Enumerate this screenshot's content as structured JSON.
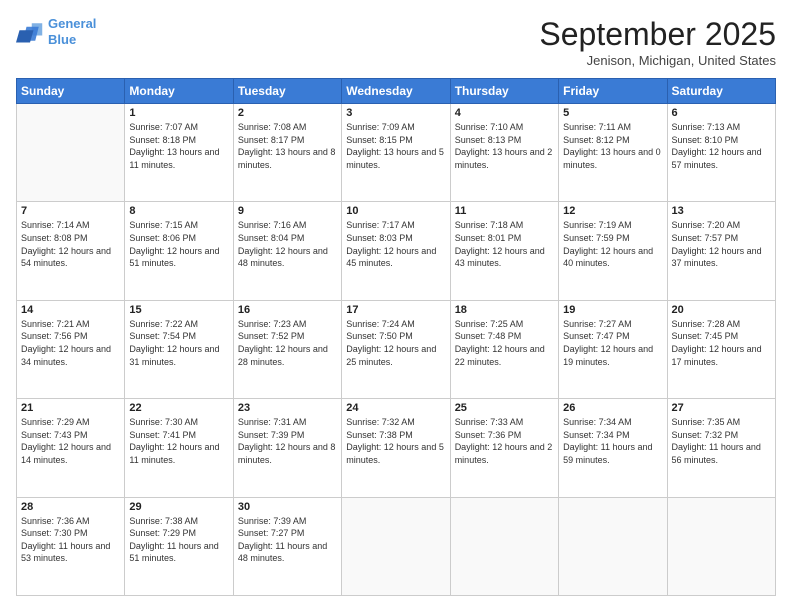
{
  "header": {
    "logo_line1": "General",
    "logo_line2": "Blue",
    "title": "September 2025",
    "location": "Jenison, Michigan, United States"
  },
  "weekdays": [
    "Sunday",
    "Monday",
    "Tuesday",
    "Wednesday",
    "Thursday",
    "Friday",
    "Saturday"
  ],
  "weeks": [
    [
      {
        "day": "",
        "sunrise": "",
        "sunset": "",
        "daylight": ""
      },
      {
        "day": "1",
        "sunrise": "Sunrise: 7:07 AM",
        "sunset": "Sunset: 8:18 PM",
        "daylight": "Daylight: 13 hours and 11 minutes."
      },
      {
        "day": "2",
        "sunrise": "Sunrise: 7:08 AM",
        "sunset": "Sunset: 8:17 PM",
        "daylight": "Daylight: 13 hours and 8 minutes."
      },
      {
        "day": "3",
        "sunrise": "Sunrise: 7:09 AM",
        "sunset": "Sunset: 8:15 PM",
        "daylight": "Daylight: 13 hours and 5 minutes."
      },
      {
        "day": "4",
        "sunrise": "Sunrise: 7:10 AM",
        "sunset": "Sunset: 8:13 PM",
        "daylight": "Daylight: 13 hours and 2 minutes."
      },
      {
        "day": "5",
        "sunrise": "Sunrise: 7:11 AM",
        "sunset": "Sunset: 8:12 PM",
        "daylight": "Daylight: 13 hours and 0 minutes."
      },
      {
        "day": "6",
        "sunrise": "Sunrise: 7:13 AM",
        "sunset": "Sunset: 8:10 PM",
        "daylight": "Daylight: 12 hours and 57 minutes."
      }
    ],
    [
      {
        "day": "7",
        "sunrise": "Sunrise: 7:14 AM",
        "sunset": "Sunset: 8:08 PM",
        "daylight": "Daylight: 12 hours and 54 minutes."
      },
      {
        "day": "8",
        "sunrise": "Sunrise: 7:15 AM",
        "sunset": "Sunset: 8:06 PM",
        "daylight": "Daylight: 12 hours and 51 minutes."
      },
      {
        "day": "9",
        "sunrise": "Sunrise: 7:16 AM",
        "sunset": "Sunset: 8:04 PM",
        "daylight": "Daylight: 12 hours and 48 minutes."
      },
      {
        "day": "10",
        "sunrise": "Sunrise: 7:17 AM",
        "sunset": "Sunset: 8:03 PM",
        "daylight": "Daylight: 12 hours and 45 minutes."
      },
      {
        "day": "11",
        "sunrise": "Sunrise: 7:18 AM",
        "sunset": "Sunset: 8:01 PM",
        "daylight": "Daylight: 12 hours and 43 minutes."
      },
      {
        "day": "12",
        "sunrise": "Sunrise: 7:19 AM",
        "sunset": "Sunset: 7:59 PM",
        "daylight": "Daylight: 12 hours and 40 minutes."
      },
      {
        "day": "13",
        "sunrise": "Sunrise: 7:20 AM",
        "sunset": "Sunset: 7:57 PM",
        "daylight": "Daylight: 12 hours and 37 minutes."
      }
    ],
    [
      {
        "day": "14",
        "sunrise": "Sunrise: 7:21 AM",
        "sunset": "Sunset: 7:56 PM",
        "daylight": "Daylight: 12 hours and 34 minutes."
      },
      {
        "day": "15",
        "sunrise": "Sunrise: 7:22 AM",
        "sunset": "Sunset: 7:54 PM",
        "daylight": "Daylight: 12 hours and 31 minutes."
      },
      {
        "day": "16",
        "sunrise": "Sunrise: 7:23 AM",
        "sunset": "Sunset: 7:52 PM",
        "daylight": "Daylight: 12 hours and 28 minutes."
      },
      {
        "day": "17",
        "sunrise": "Sunrise: 7:24 AM",
        "sunset": "Sunset: 7:50 PM",
        "daylight": "Daylight: 12 hours and 25 minutes."
      },
      {
        "day": "18",
        "sunrise": "Sunrise: 7:25 AM",
        "sunset": "Sunset: 7:48 PM",
        "daylight": "Daylight: 12 hours and 22 minutes."
      },
      {
        "day": "19",
        "sunrise": "Sunrise: 7:27 AM",
        "sunset": "Sunset: 7:47 PM",
        "daylight": "Daylight: 12 hours and 19 minutes."
      },
      {
        "day": "20",
        "sunrise": "Sunrise: 7:28 AM",
        "sunset": "Sunset: 7:45 PM",
        "daylight": "Daylight: 12 hours and 17 minutes."
      }
    ],
    [
      {
        "day": "21",
        "sunrise": "Sunrise: 7:29 AM",
        "sunset": "Sunset: 7:43 PM",
        "daylight": "Daylight: 12 hours and 14 minutes."
      },
      {
        "day": "22",
        "sunrise": "Sunrise: 7:30 AM",
        "sunset": "Sunset: 7:41 PM",
        "daylight": "Daylight: 12 hours and 11 minutes."
      },
      {
        "day": "23",
        "sunrise": "Sunrise: 7:31 AM",
        "sunset": "Sunset: 7:39 PM",
        "daylight": "Daylight: 12 hours and 8 minutes."
      },
      {
        "day": "24",
        "sunrise": "Sunrise: 7:32 AM",
        "sunset": "Sunset: 7:38 PM",
        "daylight": "Daylight: 12 hours and 5 minutes."
      },
      {
        "day": "25",
        "sunrise": "Sunrise: 7:33 AM",
        "sunset": "Sunset: 7:36 PM",
        "daylight": "Daylight: 12 hours and 2 minutes."
      },
      {
        "day": "26",
        "sunrise": "Sunrise: 7:34 AM",
        "sunset": "Sunset: 7:34 PM",
        "daylight": "Daylight: 11 hours and 59 minutes."
      },
      {
        "day": "27",
        "sunrise": "Sunrise: 7:35 AM",
        "sunset": "Sunset: 7:32 PM",
        "daylight": "Daylight: 11 hours and 56 minutes."
      }
    ],
    [
      {
        "day": "28",
        "sunrise": "Sunrise: 7:36 AM",
        "sunset": "Sunset: 7:30 PM",
        "daylight": "Daylight: 11 hours and 53 minutes."
      },
      {
        "day": "29",
        "sunrise": "Sunrise: 7:38 AM",
        "sunset": "Sunset: 7:29 PM",
        "daylight": "Daylight: 11 hours and 51 minutes."
      },
      {
        "day": "30",
        "sunrise": "Sunrise: 7:39 AM",
        "sunset": "Sunset: 7:27 PM",
        "daylight": "Daylight: 11 hours and 48 minutes."
      },
      {
        "day": "",
        "sunrise": "",
        "sunset": "",
        "daylight": ""
      },
      {
        "day": "",
        "sunrise": "",
        "sunset": "",
        "daylight": ""
      },
      {
        "day": "",
        "sunrise": "",
        "sunset": "",
        "daylight": ""
      },
      {
        "day": "",
        "sunrise": "",
        "sunset": "",
        "daylight": ""
      }
    ]
  ]
}
